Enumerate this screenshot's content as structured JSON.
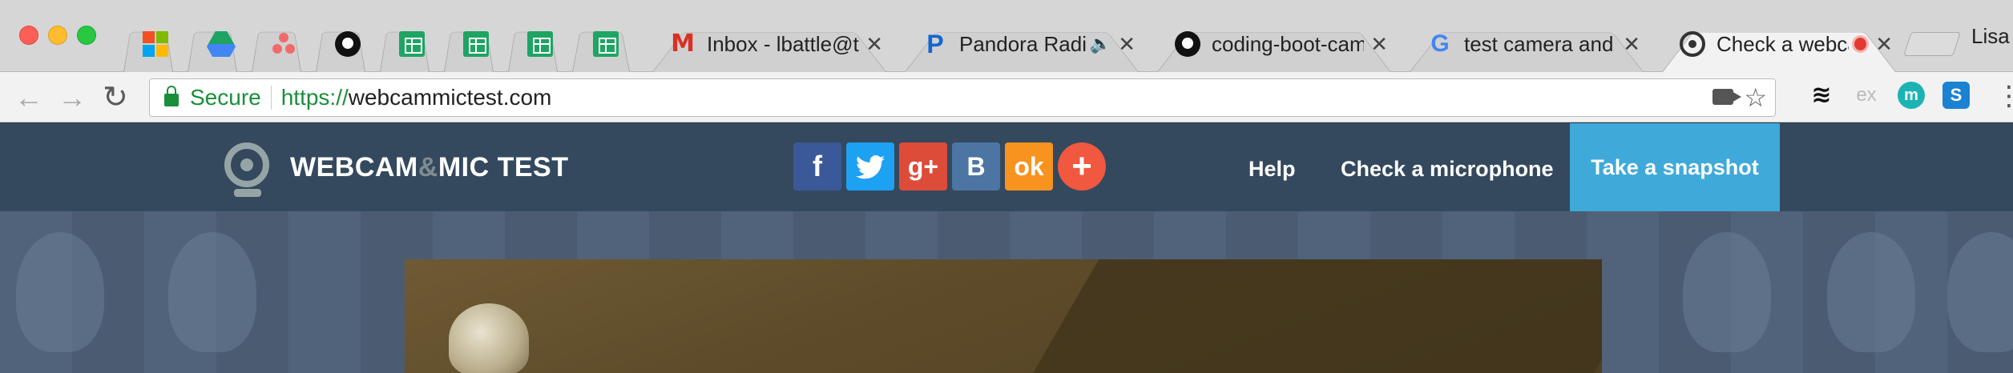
{
  "browser": {
    "tabs": [
      {
        "title": "",
        "favicon": "microsoft-icon"
      },
      {
        "title": "",
        "favicon": "google-drive-icon"
      },
      {
        "title": "",
        "favicon": "asana-icon"
      },
      {
        "title": "",
        "favicon": "github-icon"
      },
      {
        "title": "",
        "favicon": "google-sheets-icon"
      },
      {
        "title": "",
        "favicon": "google-sheets-icon"
      },
      {
        "title": "",
        "favicon": "google-sheets-icon"
      },
      {
        "title": "",
        "favicon": "google-sheets-icon"
      },
      {
        "title": "Inbox - lbattle@tri",
        "favicon": "gmail-icon"
      },
      {
        "title": "Pandora Radio",
        "favicon": "pandora-icon",
        "audio": true
      },
      {
        "title": "coding-boot-camp",
        "favicon": "github-icon"
      },
      {
        "title": "test camera and m",
        "favicon": "google-icon"
      },
      {
        "title": "Check a webca",
        "favicon": "webcam-icon",
        "recording": true,
        "active": true
      }
    ],
    "close_glyph": "✕",
    "profile_name": "Lisa",
    "toolbar": {
      "back": "←",
      "forward": "→",
      "reload": "↻",
      "secure_label": "Secure",
      "url_scheme": "https://",
      "url_host": "webcammictest.com",
      "star": "☆",
      "menu": "⋮"
    },
    "extensions": [
      {
        "name": "buffer-icon",
        "glyph": "≋"
      },
      {
        "name": "ex-icon",
        "glyph": "ex"
      },
      {
        "name": "m-icon",
        "glyph": "m"
      },
      {
        "name": "s-icon",
        "glyph": "S"
      }
    ]
  },
  "site": {
    "logo": {
      "part1": "WEBCAM",
      "amp": "&",
      "part2": "MIC TEST"
    },
    "social": [
      {
        "name": "facebook",
        "glyph": "f",
        "color": "#3b5998"
      },
      {
        "name": "twitter",
        "glyph": "🐦",
        "color": "#1da1f2"
      },
      {
        "name": "google-plus",
        "glyph": "g+",
        "color": "#dd4b39"
      },
      {
        "name": "vk",
        "glyph": "B",
        "color": "#4c75a3"
      },
      {
        "name": "odnoklassniki",
        "glyph": "ok",
        "color": "#f7931e"
      },
      {
        "name": "more",
        "glyph": "+",
        "color": "#f0583f"
      }
    ],
    "nav": {
      "help": "Help",
      "check_microphone": "Check a microphone",
      "take_snapshot": "Take a snapshot"
    },
    "colors": {
      "header": "#34495e",
      "snapshot_button": "#3fa9d9"
    }
  }
}
